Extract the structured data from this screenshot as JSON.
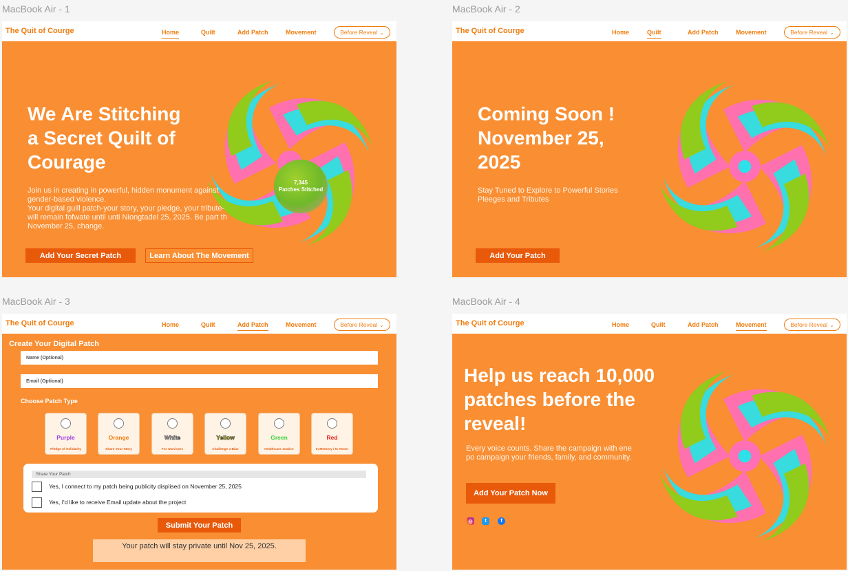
{
  "frames": {
    "f1": "MacBook Air - 1",
    "f2": "MacBook Air - 2",
    "f3": "MacBook Air - 3",
    "f4": "MacBook Air - 4"
  },
  "nav": {
    "brand": "The Quit of Courge",
    "home": "Home",
    "quilt": "Quilt",
    "add_patch": "Add Patch",
    "movement": "Movement",
    "dropdown": "Before Reveal"
  },
  "screen1": {
    "title_lines": [
      "We Are Stitching",
      "a Secret Quilt of",
      "Courage"
    ],
    "body_lines": [
      "Join us in creating in powerful, hidden monument against",
      "gender-based violence.",
      "Your digital guill patch-your story, your pledge, your tribute-",
      "will remain fofwate until unti Niongtadel 25, 2025. Be part th",
      "November 25, change."
    ],
    "counter_value": "7,345",
    "counter_label": "Patches Stitched",
    "primary_button": "Add Your Secret Patch",
    "secondary_button": "Learn About The Movement"
  },
  "screen2": {
    "title_lines": [
      "Coming Soon !",
      "November 25,",
      "2025"
    ],
    "body_lines": [
      "Stay Tuned to Explore to Powerful Stories",
      "Pleeges and Tributes"
    ],
    "button": "Add Your  Patch"
  },
  "screen3": {
    "form_title": "Create Your Digital Patch",
    "name_placeholder": "Name (Optional)",
    "email_placeholder": "Email (Optional)",
    "choose_label": "Choose Patch Type",
    "patches": [
      {
        "name": "Purple",
        "sub": "Pledge of Solidarity",
        "color": "#9b3fe0"
      },
      {
        "name": "Orange",
        "sub": "Share Your Story",
        "color": "#f07c0e"
      },
      {
        "name": "White",
        "sub": "For Survivors",
        "color": "#ffffff"
      },
      {
        "name": "Yellow",
        "sub": "Challenge a Bias",
        "color": "#f4ee1c"
      },
      {
        "name": "Green",
        "sub": "Healthcare Justice",
        "color": "#3bd33b"
      },
      {
        "name": "Red",
        "sub": "In Memory / In Honor",
        "color": "#e21b1b"
      }
    ],
    "share_header": "Share Your Patch",
    "consent_1": "Yes, I connect to my patch being publicity displised on November 25, 2025",
    "consent_2": "Yes, I'd like to receive Email update about the project",
    "submit": "Submit Your Patch",
    "note": "Your patch will stay private until Nov 25, 2025."
  },
  "screen4": {
    "title_lines": [
      "Help us reach 10,000",
      "patches before the",
      "reveal!"
    ],
    "body_lines": [
      "Every voice counts. Share the campaign with ene",
      "po campaign your friends, family, and community."
    ],
    "button": "Add Your Patch Now",
    "social_icons": [
      "instagram-icon",
      "twitter-icon",
      "facebook-icon"
    ]
  },
  "colors": {
    "orange_bg": "#f98e32",
    "accent": "#f07c0e",
    "button": "#e8590a",
    "swirl_pink": "#ff6fb5",
    "swirl_cyan": "#2ee0e8",
    "swirl_green": "#8ccf1a"
  }
}
